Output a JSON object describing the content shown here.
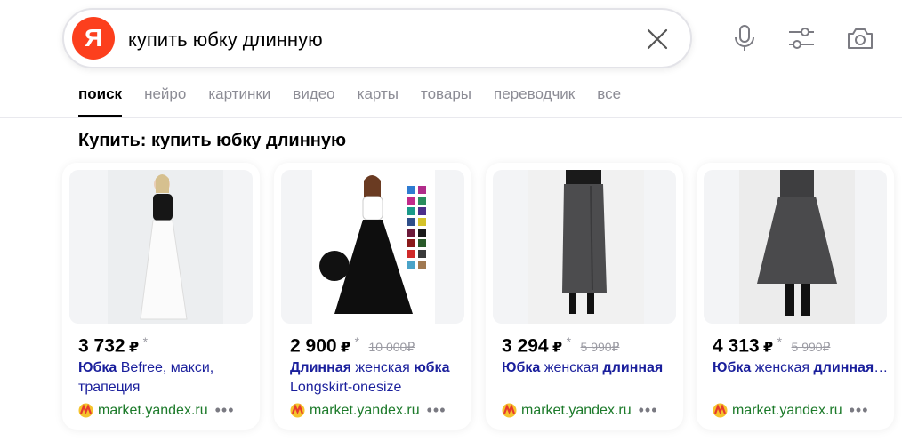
{
  "search": {
    "logo_letter": "Я",
    "query": "купить юбку длинную"
  },
  "icons": {
    "clear": "close-icon",
    "mic": "microphone-icon",
    "filters": "filters-icon",
    "camera": "camera-icon"
  },
  "tabs": [
    {
      "label": "поиск",
      "active": true
    },
    {
      "label": "нейро"
    },
    {
      "label": "картинки"
    },
    {
      "label": "видео"
    },
    {
      "label": "карты"
    },
    {
      "label": "товары"
    },
    {
      "label": "переводчик"
    },
    {
      "label": "все"
    }
  ],
  "section": {
    "title": "Купить: купить юбку длинную"
  },
  "products": [
    {
      "price": "3 732",
      "currency": "₽",
      "star": "*",
      "old_price": "",
      "title_bold": "Юбка",
      "title_rest": " Befree, макси, трапеция",
      "source": "market.yandex.ru",
      "more": "•••"
    },
    {
      "price": "2 900",
      "currency": "₽",
      "star": "*",
      "old_price": "10 000₽",
      "title_bold": "Длинная",
      "title_rest": " женская ",
      "title_bold2": "юбка",
      "title_rest2": " Longskirt-onesize",
      "source": "market.yandex.ru",
      "more": "•••"
    },
    {
      "price": "3 294",
      "currency": "₽",
      "star": "*",
      "old_price": "5 990₽",
      "title_bold": "Юбка",
      "title_rest": " женская ",
      "title_bold2": "длинная",
      "title_rest2": "",
      "source": "market.yandex.ru",
      "more": "•••"
    },
    {
      "price": "4 313",
      "currency": "₽",
      "star": "*",
      "old_price": "5 990₽",
      "title_bold": "Юбка",
      "title_rest": " женская ",
      "title_bold2": "длинная",
      "title_rest2": "…",
      "source": "market.yandex.ru",
      "more": "•••"
    }
  ],
  "colors": {
    "logo": "#fc3f1d",
    "link": "#1a1f9c",
    "source": "#1c7a2a",
    "muted": "#8c8c95"
  }
}
